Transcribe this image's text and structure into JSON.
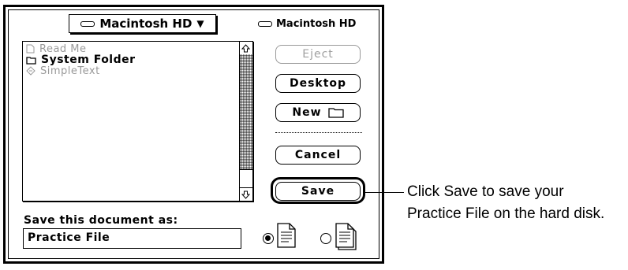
{
  "dialog": {
    "folder_popup": "Macintosh HD",
    "volume_name": "Macintosh HD",
    "files": [
      {
        "name": "Read Me",
        "icon": "document-icon",
        "enabled": false
      },
      {
        "name": "System Folder",
        "icon": "folder-icon",
        "enabled": true
      },
      {
        "name": "SimpleText",
        "icon": "application-icon",
        "enabled": false
      }
    ],
    "buttons": {
      "eject": "Eject",
      "desktop": "Desktop",
      "new": "New",
      "cancel": "Cancel",
      "save": "Save"
    },
    "save_prompt": "Save this document as:",
    "file_name": "Practice File",
    "format_options": [
      "document",
      "stationery"
    ],
    "selected_format": "document"
  },
  "callout": {
    "line1": "Click Save to save your",
    "line2": "Practice File on the hard disk."
  }
}
